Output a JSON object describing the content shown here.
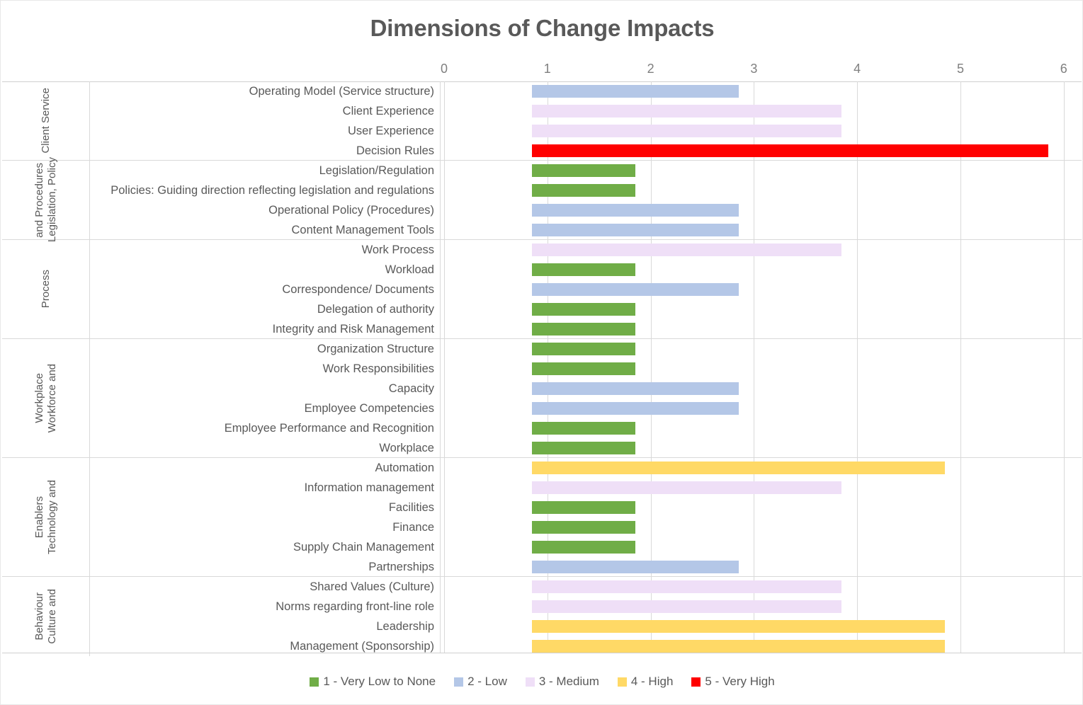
{
  "chart_data": {
    "type": "bar",
    "orientation": "horizontal",
    "title": "Dimensions of Change Impacts",
    "xlabel": "",
    "ylabel": "",
    "xlim": [
      0,
      6
    ],
    "xticks": [
      "0",
      "1",
      "2",
      "3",
      "4",
      "5",
      "6"
    ],
    "grid": true,
    "legend_position": "bottom",
    "legend": [
      {
        "label": "1 - Very Low to None",
        "value": 1,
        "color": "#70AD47"
      },
      {
        "label": "2 - Low",
        "value": 2,
        "color": "#B4C7E7"
      },
      {
        "label": "3 - Medium",
        "value": 3,
        "color": "#EFDFF7"
      },
      {
        "label": "4 - High",
        "value": 4,
        "color": "#FFD966"
      },
      {
        "label": "5 - Very High",
        "value": 5,
        "color": "#FF0000"
      }
    ],
    "groups": [
      {
        "name": "Client Service",
        "name_lines": [
          "Client Service"
        ],
        "items": [
          {
            "label": "Operating Model (Service structure)",
            "value": 2
          },
          {
            "label": "Client Experience",
            "value": 3
          },
          {
            "label": "User Experience",
            "value": 3
          },
          {
            "label": "Decision Rules",
            "value": 5
          }
        ]
      },
      {
        "name": "Legislation, Policy and Procedures",
        "name_lines": [
          "Legislation, Policy",
          "and Procedures"
        ],
        "items": [
          {
            "label": "Legislation/Regulation",
            "value": 1
          },
          {
            "label": "Policies:  Guiding direction reflecting legislation and regulations",
            "value": 1
          },
          {
            "label": "Operational Policy (Procedures)",
            "value": 2
          },
          {
            "label": "Content Management Tools",
            "value": 2
          }
        ]
      },
      {
        "name": "Process",
        "name_lines": [
          "Process"
        ],
        "items": [
          {
            "label": "Work Process",
            "value": 3
          },
          {
            "label": "Workload",
            "value": 1
          },
          {
            "label": "Correspondence/ Documents",
            "value": 2
          },
          {
            "label": "Delegation of authority",
            "value": 1
          },
          {
            "label": "Integrity and Risk Management",
            "value": 1
          }
        ]
      },
      {
        "name": "Workforce and Workplace",
        "name_lines": [
          "Workforce and",
          "Workplace"
        ],
        "items": [
          {
            "label": "Organization Structure",
            "value": 1
          },
          {
            "label": "Work Responsibilities",
            "value": 1
          },
          {
            "label": "Capacity",
            "value": 2
          },
          {
            "label": "Employee Competencies",
            "value": 2
          },
          {
            "label": "Employee Performance and Recognition",
            "value": 1
          },
          {
            "label": "Workplace",
            "value": 1
          }
        ]
      },
      {
        "name": "Technology and Enablers",
        "name_lines": [
          "Technology and",
          "Enablers"
        ],
        "items": [
          {
            "label": "Automation",
            "value": 4
          },
          {
            "label": "Information management",
            "value": 3
          },
          {
            "label": "Facilities",
            "value": 1
          },
          {
            "label": "Finance",
            "value": 1
          },
          {
            "label": "Supply Chain Management",
            "value": 1
          },
          {
            "label": "Partnerships",
            "value": 2
          }
        ]
      },
      {
        "name": "Culture and Behaviour",
        "name_lines": [
          "Culture and",
          "Behaviour"
        ],
        "items": [
          {
            "label": "Shared Values (Culture)",
            "value": 3
          },
          {
            "label": "Norms regarding front-line role",
            "value": 3
          },
          {
            "label": "Leadership",
            "value": 4
          },
          {
            "label": "Management (Sponsorship)",
            "value": 4
          }
        ]
      }
    ]
  }
}
